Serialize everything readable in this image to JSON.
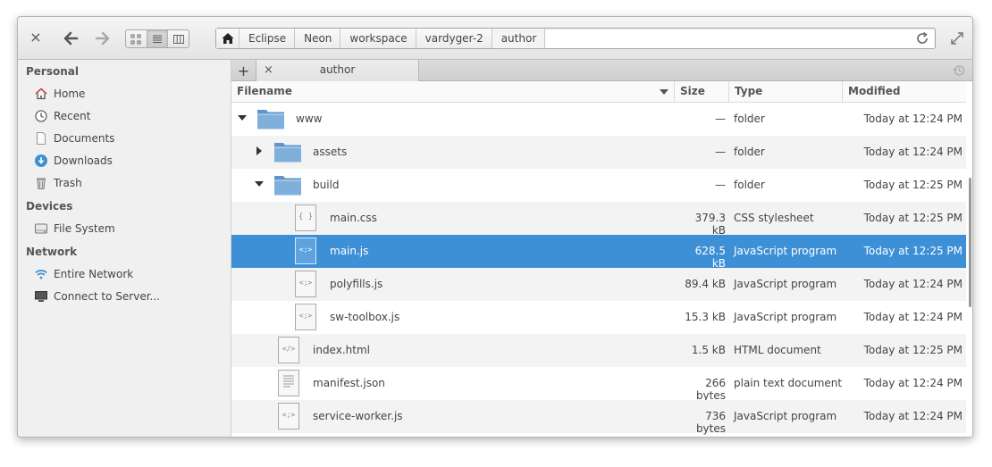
{
  "header": {
    "close_glyph": "×",
    "breadcrumbs": [
      "Eclipse",
      "Neon",
      "workspace",
      "vardyger-2",
      "author"
    ]
  },
  "sidebar": {
    "sections": [
      {
        "heading": "Personal",
        "items": [
          {
            "label": "Home",
            "icon": "home-icon"
          },
          {
            "label": "Recent",
            "icon": "recent-icon"
          },
          {
            "label": "Documents",
            "icon": "documents-icon"
          },
          {
            "label": "Downloads",
            "icon": "downloads-icon"
          },
          {
            "label": "Trash",
            "icon": "trash-icon"
          }
        ]
      },
      {
        "heading": "Devices",
        "items": [
          {
            "label": "File System",
            "icon": "drive-icon"
          }
        ]
      },
      {
        "heading": "Network",
        "items": [
          {
            "label": "Entire Network",
            "icon": "network-icon"
          },
          {
            "label": "Connect to Server...",
            "icon": "server-icon"
          }
        ]
      }
    ]
  },
  "tabs": {
    "add_glyph": "+",
    "close_glyph": "×",
    "active_label": "author"
  },
  "columns": {
    "filename": "Filename",
    "size": "Size",
    "type": "Type",
    "modified": "Modified"
  },
  "files": [
    {
      "name": "www",
      "size": "—",
      "type": "folder",
      "modified": "Today at 12:24 PM",
      "depth": 0,
      "kind": "folder",
      "expander": "open"
    },
    {
      "name": "assets",
      "size": "—",
      "type": "folder",
      "modified": "Today at 12:24 PM",
      "depth": 1,
      "kind": "folder",
      "expander": "closed"
    },
    {
      "name": "build",
      "size": "—",
      "type": "folder",
      "modified": "Today at 12:25 PM",
      "depth": 1,
      "kind": "folder",
      "expander": "open"
    },
    {
      "name": "main.css",
      "size": "379.3 kB",
      "type": "CSS stylesheet",
      "modified": "Today at 12:25 PM",
      "depth": 2,
      "kind": "css"
    },
    {
      "name": "main.js",
      "size": "628.5 kB",
      "type": "JavaScript program",
      "modified": "Today at 12:25 PM",
      "depth": 2,
      "kind": "js",
      "selected": true
    },
    {
      "name": "polyfills.js",
      "size": "89.4 kB",
      "type": "JavaScript program",
      "modified": "Today at 12:24 PM",
      "depth": 2,
      "kind": "js"
    },
    {
      "name": "sw-toolbox.js",
      "size": "15.3 kB",
      "type": "JavaScript program",
      "modified": "Today at 12:24 PM",
      "depth": 2,
      "kind": "js"
    },
    {
      "name": "index.html",
      "size": "1.5 kB",
      "type": "HTML document",
      "modified": "Today at 12:25 PM",
      "depth": 1,
      "kind": "html"
    },
    {
      "name": "manifest.json",
      "size": "266 bytes",
      "type": "plain text document",
      "modified": "Today at 12:24 PM",
      "depth": 1,
      "kind": "text"
    },
    {
      "name": "service-worker.js",
      "size": "736 bytes",
      "type": "JavaScript program",
      "modified": "Today at 12:24 PM",
      "depth": 1,
      "kind": "js"
    }
  ],
  "colors": {
    "selection": "#3d8fd6",
    "folder": "#7fb0dc",
    "download": "#3d8fd6"
  }
}
